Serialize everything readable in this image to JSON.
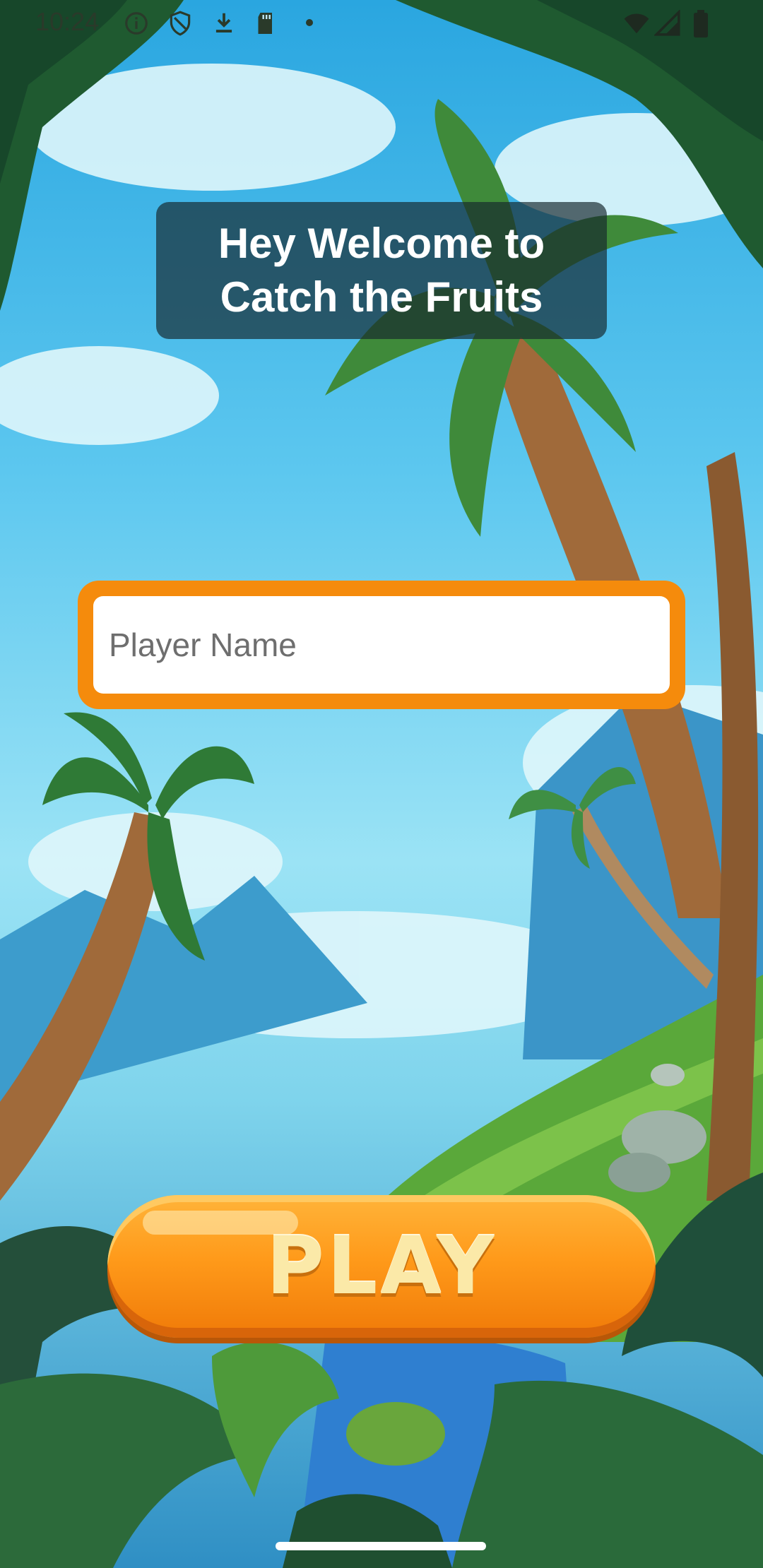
{
  "status_bar": {
    "time": "10:24",
    "left_icons": [
      "info-icon",
      "shield-icon",
      "download-icon",
      "sd-card-icon",
      "dot-icon"
    ],
    "right_icons": [
      "wifi-icon",
      "signal-icon",
      "battery-icon"
    ]
  },
  "welcome": {
    "title": "Hey Welcome to\nCatch the Fruits"
  },
  "player_input": {
    "value": "",
    "placeholder": "Player Name"
  },
  "play_button": {
    "label": "PLAY"
  },
  "colors": {
    "input_border": "#f58b0c",
    "play_button": "#ff9a1a",
    "title_panel": "#16282d"
  }
}
